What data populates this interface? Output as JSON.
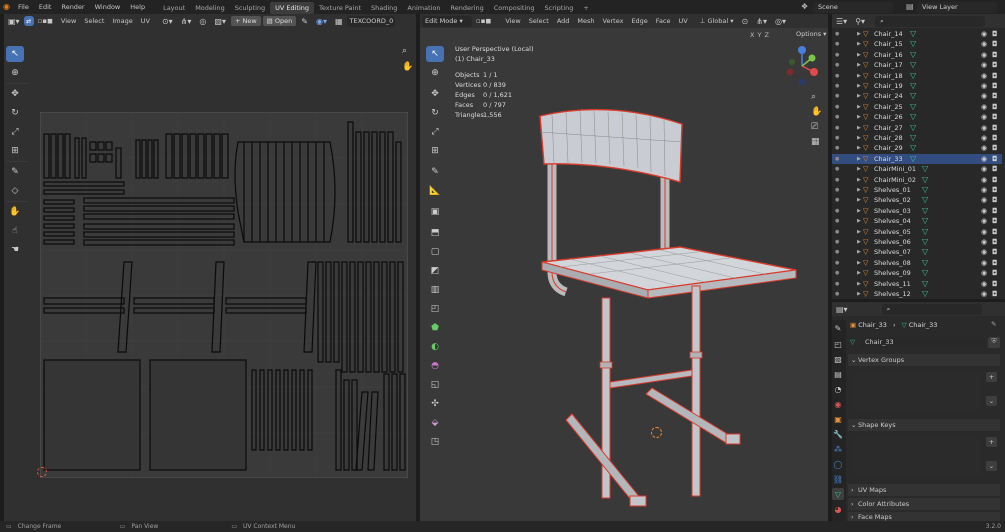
{
  "topbar": {
    "menus": [
      "File",
      "Edit",
      "Render",
      "Window",
      "Help"
    ],
    "workspaces": [
      {
        "label": "Layout",
        "active": false
      },
      {
        "label": "Modeling",
        "active": false
      },
      {
        "label": "Sculpting",
        "active": false
      },
      {
        "label": "UV Editing",
        "active": true
      },
      {
        "label": "Texture Paint",
        "active": false
      },
      {
        "label": "Shading",
        "active": false
      },
      {
        "label": "Animation",
        "active": false
      },
      {
        "label": "Rendering",
        "active": false
      },
      {
        "label": "Compositing",
        "active": false
      },
      {
        "label": "Scripting",
        "active": false
      }
    ],
    "add_tab": "+",
    "scene": "Scene",
    "view_layer": "View Layer"
  },
  "uv_editor": {
    "menus": [
      "View",
      "Select",
      "Image",
      "UV"
    ],
    "new_label": "New",
    "open_label": "Open",
    "uvmap": "TEXCOORD_0"
  },
  "viewport": {
    "mode": "Edit Mode",
    "menus": [
      "View",
      "Select",
      "Add",
      "Mesh",
      "Vertex",
      "Edge",
      "Face",
      "UV"
    ],
    "orientation": "Global",
    "axes": "X Y Z",
    "options": "Options",
    "perspective": "User Perspective (Local)",
    "object_name": "(1) Chair_33",
    "stats": [
      {
        "label": "Objects",
        "value": "1 / 1"
      },
      {
        "label": "Vertices",
        "value": "0 / 839"
      },
      {
        "label": "Edges",
        "value": "0 / 1,621"
      },
      {
        "label": "Faces",
        "value": "0 / 797"
      },
      {
        "label": "Triangles",
        "value": "1,556"
      }
    ]
  },
  "outliner": {
    "items": [
      {
        "label": "Chair_14",
        "selected": false
      },
      {
        "label": "Chair_15",
        "selected": false
      },
      {
        "label": "Chair_16",
        "selected": false
      },
      {
        "label": "Chair_17",
        "selected": false
      },
      {
        "label": "Chair_18",
        "selected": false
      },
      {
        "label": "Chair_19",
        "selected": false
      },
      {
        "label": "Chair_24",
        "selected": false
      },
      {
        "label": "Chair_25",
        "selected": false
      },
      {
        "label": "Chair_26",
        "selected": false
      },
      {
        "label": "Chair_27",
        "selected": false
      },
      {
        "label": "Chair_28",
        "selected": false
      },
      {
        "label": "Chair_29",
        "selected": false
      },
      {
        "label": "Chair_33",
        "selected": true
      },
      {
        "label": "ChairMini_01",
        "selected": false
      },
      {
        "label": "ChairMini_02",
        "selected": false
      },
      {
        "label": "Shelves_01",
        "selected": false
      },
      {
        "label": "Shelves_02",
        "selected": false
      },
      {
        "label": "Shelves_03",
        "selected": false
      },
      {
        "label": "Shelves_04",
        "selected": false
      },
      {
        "label": "Shelves_05",
        "selected": false
      },
      {
        "label": "Shelves_06",
        "selected": false
      },
      {
        "label": "Shelves_07",
        "selected": false
      },
      {
        "label": "Shelves_08",
        "selected": false
      },
      {
        "label": "Shelves_09",
        "selected": false
      },
      {
        "label": "Shelves_11",
        "selected": false
      },
      {
        "label": "Shelves_12",
        "selected": false
      }
    ]
  },
  "properties": {
    "breadcrumb_object": "Chair_33",
    "breadcrumb_mesh": "Chair_33",
    "mesh_name": "Chair_33",
    "sections": {
      "vertex_groups": "Vertex Groups",
      "shape_keys": "Shape Keys",
      "uv_maps": "UV Maps",
      "color_attributes": "Color Attributes",
      "face_maps": "Face Maps"
    }
  },
  "statusbar": {
    "items": [
      "Change Frame",
      "Pan View",
      "UV Context Menu"
    ],
    "version": "3.2.0"
  },
  "colors": {
    "accent": "#4772b3",
    "mesh_edge": "#d93a2a",
    "selected_row": "#334d80",
    "object_icon": "#e8913a",
    "mesh_icon": "#37c3a0"
  }
}
